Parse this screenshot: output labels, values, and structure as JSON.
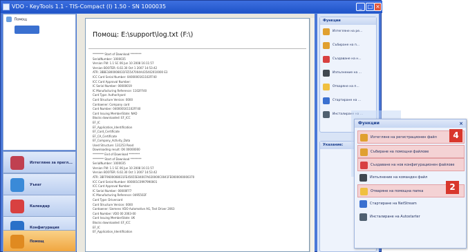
{
  "window": {
    "title": "VDO - KeyTools 1.1 - TIS-Compact (I) 1.50 - SN 1000035",
    "min_symbol": "_",
    "max_symbol": "□",
    "close_symbol": "×"
  },
  "left_tree": {
    "root_label": "Помощ"
  },
  "nav": {
    "items": [
      {
        "label": "Изтегляне за прегл...",
        "icon": "download-icon",
        "color": "#c04050"
      },
      {
        "label": "Уъкеr",
        "icon": "user-icon",
        "color": "#3a8ad8"
      },
      {
        "label": "Календар",
        "icon": "calendar-icon",
        "color": "#d84040"
      },
      {
        "label": "Конфигурация",
        "icon": "settings-icon",
        "color": "#2a70c8"
      },
      {
        "label": "Помощ",
        "icon": "help-icon",
        "color": "#e08a20"
      }
    ]
  },
  "document": {
    "heading": "Помощ: E:\\support\\log.txt    (F:\\)",
    "log_lines": [
      "******** Start of Download ********",
      "SerialNumber: 1000035",
      "Version FW: 1.1 SC 06 Jun 10 2008 16:11:57",
      "Version BOOTER: 6.02.30 Oct 1 2007 14:53:42",
      "ATR: 3BBE1800008031FE5547004A435402010000 E3",
      "ICC Card Serial Number: 0400000161102FF40",
      "ICC Card Approval Number:",
      "IC Serial Number: 00000019",
      "IC Manufacturing Reference: 1102FF40",
      "Card Type: Authorityard",
      "Card Structure Version: 0000",
      "Cardowner: Company card",
      "Card Number: 040000161102FF40",
      "Card Issuing MemberState: NAD",
      "Blocks downloaded: EF_ICC",
      "                 EF_IC",
      "                 EF_Application_Identification",
      "                 EF_Card_Certificate",
      "                 EF_CA_Certificate",
      "                 EF_Company_Activity_Data",
      "Used Structure: 131253 Read",
      "Downloading result: OK 00000000",
      "******** End of Download ********",
      "******** Start of Download ********",
      "SerialNumber: 1000035",
      "Version FW: 1.1 SC 06 Jun 10 2008 16:11:57",
      "Version BOOTER: 6.02.30 Oct 1 2007 14:53:42",
      "ATR: 3BFF9600008031FE45655E04007A020000C0041FE0000000000370",
      "ICC Card Serial Number: 000001C0997990001",
      "ICC Card Approval Number:",
      "IC Serial Number: 00000FF7",
      "IC Manufacturing Reference: 0495502F",
      "Card Type: Drivercard",
      "Card Structure Version: 0000",
      "Cardowner: Siemens VDO Automotive AG, Test Driver 2063",
      "Card Number: VDO 00  2063-00",
      "Card Issuing MemberState: UK",
      "Blocks downloaded: EF_ICC",
      "                 EF_IC",
      "                 EF_Application_Identification"
    ]
  },
  "functions_panel": {
    "title": "Функции",
    "items": [
      {
        "label": "Изтегляне на ре...",
        "icon": "download-icon",
        "color": "#e0a030"
      },
      {
        "label": "Събиране на п...",
        "icon": "collect-icon",
        "color": "#e0a030"
      },
      {
        "label": "Създаване на н...",
        "icon": "create-icon",
        "color": "#d84040"
      },
      {
        "label": "Изпълнение на ...",
        "icon": "execute-icon",
        "color": "#404850"
      },
      {
        "label": "Отваряне на п...",
        "icon": "folder-icon",
        "color": "#f0c040"
      },
      {
        "label": "Стартиране на ...",
        "icon": "start-icon",
        "color": "#3a70d0"
      },
      {
        "label": "Инсталиране на ...",
        "icon": "install-icon",
        "color": "#506070"
      }
    ]
  },
  "note_panel": {
    "title": "Указание:"
  },
  "zoom_panel": {
    "title": "Функции",
    "close_symbol": "×",
    "items": [
      {
        "label": "Изтегляне на регистрационен файл",
        "icon": "download-icon",
        "color": "#e0a030",
        "highlight": true
      },
      {
        "label": "Събиране на помощни файлове",
        "icon": "collect-icon",
        "color": "#e0a030",
        "highlight": true
      },
      {
        "label": "Създаване на нов конфигурационен файлове",
        "icon": "create-icon",
        "color": "#d84040",
        "highlight": true
      },
      {
        "label": "Изпълнение на команден файл",
        "icon": "execute-icon",
        "color": "#404850",
        "highlight": false
      },
      {
        "label": "Отваряне на помощна папка",
        "icon": "folder-icon",
        "color": "#f0c040",
        "highlight": true
      },
      {
        "label": "Стартиране на NetStream",
        "icon": "start-icon",
        "color": "#3a70d0",
        "highlight": false
      },
      {
        "label": "Инсталиране на Autostarter",
        "icon": "install-icon",
        "color": "#506070",
        "highlight": false
      }
    ]
  },
  "callouts": [
    "4",
    "2"
  ]
}
